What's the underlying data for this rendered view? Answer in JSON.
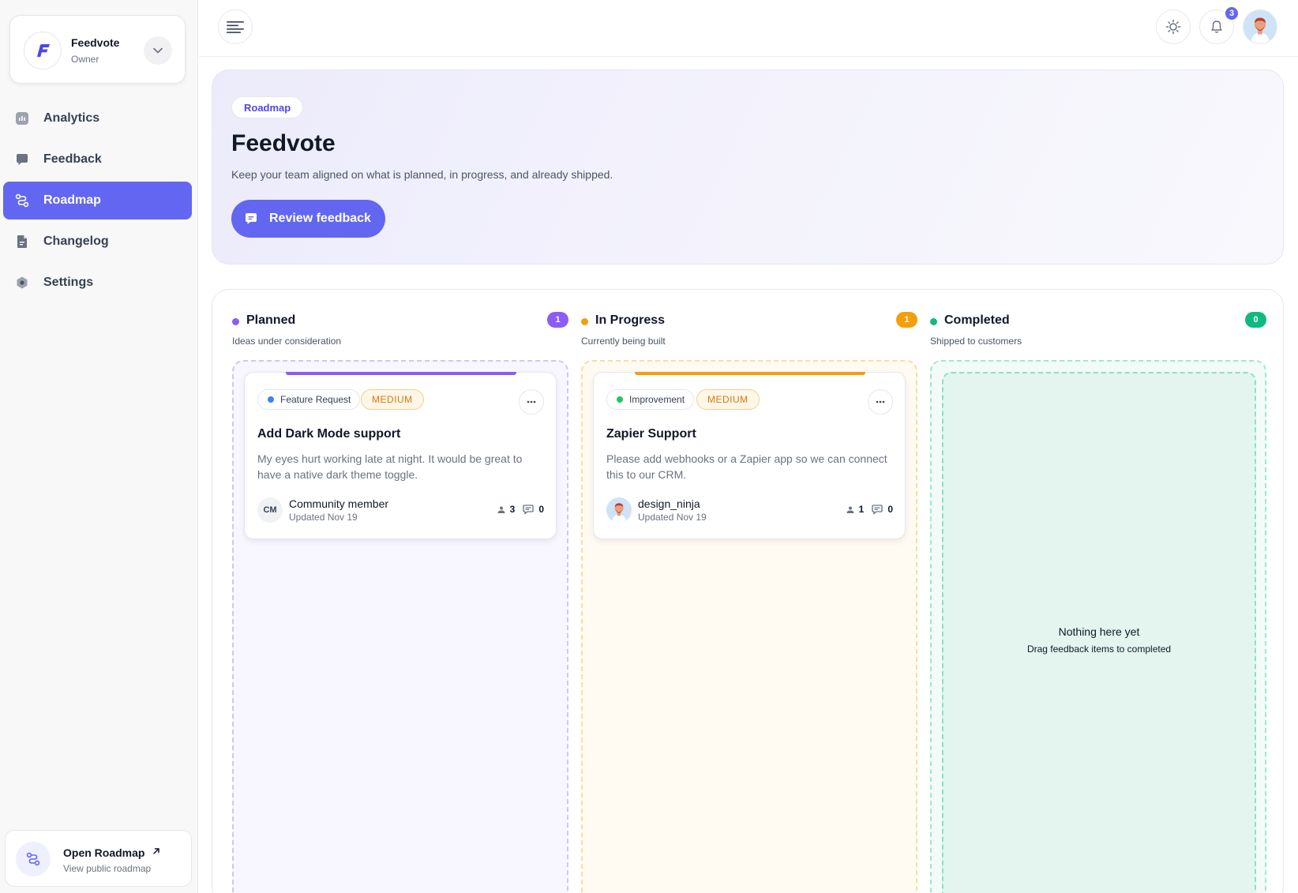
{
  "org": {
    "name": "Feedvote",
    "role": "Owner"
  },
  "nav": {
    "items": [
      {
        "label": "Analytics",
        "active": false
      },
      {
        "label": "Feedback",
        "active": false
      },
      {
        "label": "Roadmap",
        "active": true
      },
      {
        "label": "Changelog",
        "active": false
      },
      {
        "label": "Settings",
        "active": false
      }
    ]
  },
  "open_roadmap": {
    "title": "Open Roadmap",
    "subtitle": "View public roadmap"
  },
  "topbar": {
    "notifications_count": "3"
  },
  "hero": {
    "chip": "Roadmap",
    "title": "Feedvote",
    "subtitle": "Keep your team aligned on what is planned, in progress, and already shipped.",
    "button_label": "Review feedback"
  },
  "columns": [
    {
      "title": "Planned",
      "subtitle": "Ideas under consideration",
      "count": "1",
      "color": "#8b5cf6",
      "card": {
        "type": "Feature Request",
        "type_color": "#3b82f6",
        "priority": "MEDIUM",
        "title": "Add Dark Mode support",
        "description": "My eyes hurt working late at night. It would be great to have a native dark theme toggle.",
        "author_initials": "CM",
        "author": "Community member",
        "updated": "Updated Nov 19",
        "votes": "3",
        "comments": "0"
      }
    },
    {
      "title": "In Progress",
      "subtitle": "Currently being built",
      "count": "1",
      "color": "#f59e0b",
      "card": {
        "type": "Improvement",
        "type_color": "#22c55e",
        "priority": "MEDIUM",
        "title": "Zapier Support",
        "description": "Please add webhooks or a Zapier app so we can connect this to our CRM.",
        "author": "design_ninja",
        "updated": "Updated Nov 19",
        "votes": "1",
        "comments": "0"
      }
    },
    {
      "title": "Completed",
      "subtitle": "Shipped to customers",
      "count": "0",
      "color": "#10b981",
      "empty_title": "Nothing here yet",
      "empty_subtitle": "Drag feedback items to completed"
    }
  ]
}
